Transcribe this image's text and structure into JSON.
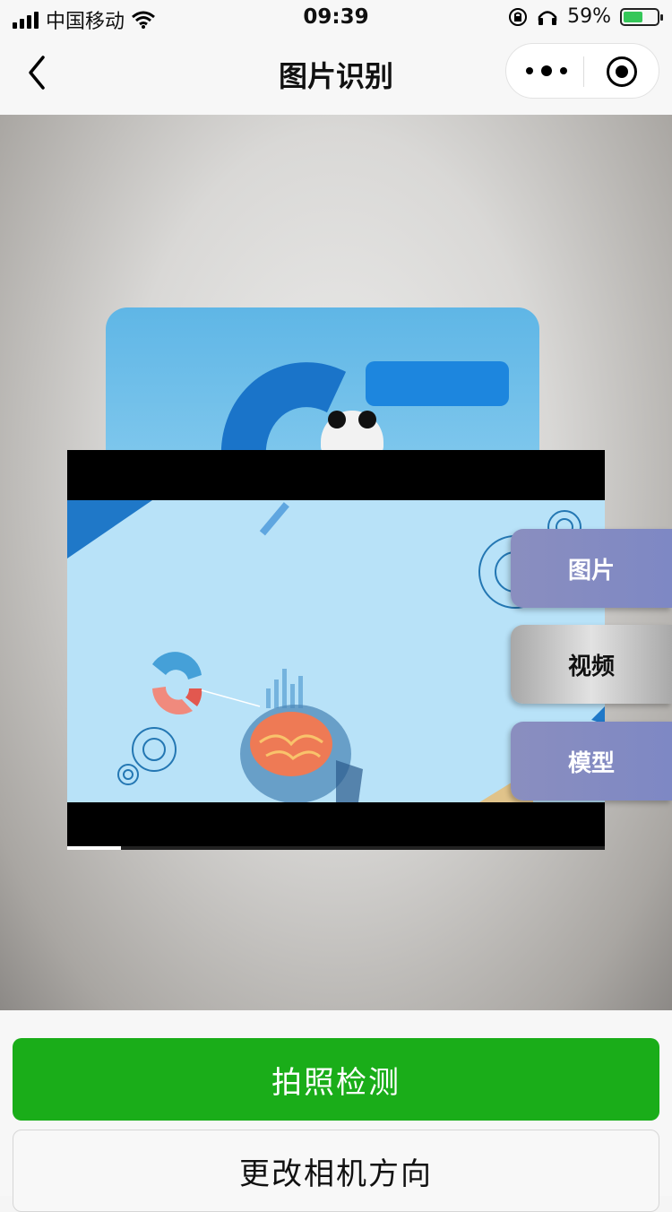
{
  "status_bar": {
    "carrier": "中国移动",
    "time": "09:39",
    "battery_percent": "59%",
    "battery_level": 0.59,
    "icons": [
      "signal-icon",
      "wifi-icon",
      "orientation-lock-icon",
      "headphones-icon",
      "battery-icon"
    ]
  },
  "nav": {
    "title": "图片识别",
    "icons": [
      "back-chevron-icon",
      "more-dots-icon",
      "target-circle-icon"
    ]
  },
  "video": {
    "progress": 0.1
  },
  "side_menu": {
    "picture": "图片",
    "video": "视频",
    "model": "模型"
  },
  "actions": {
    "capture": "拍照检测",
    "change_camera": "更改相机方向"
  },
  "colors": {
    "primary_button": "#1aad19",
    "side_button": "#8088c2",
    "video_background": "#b8e2f8"
  }
}
